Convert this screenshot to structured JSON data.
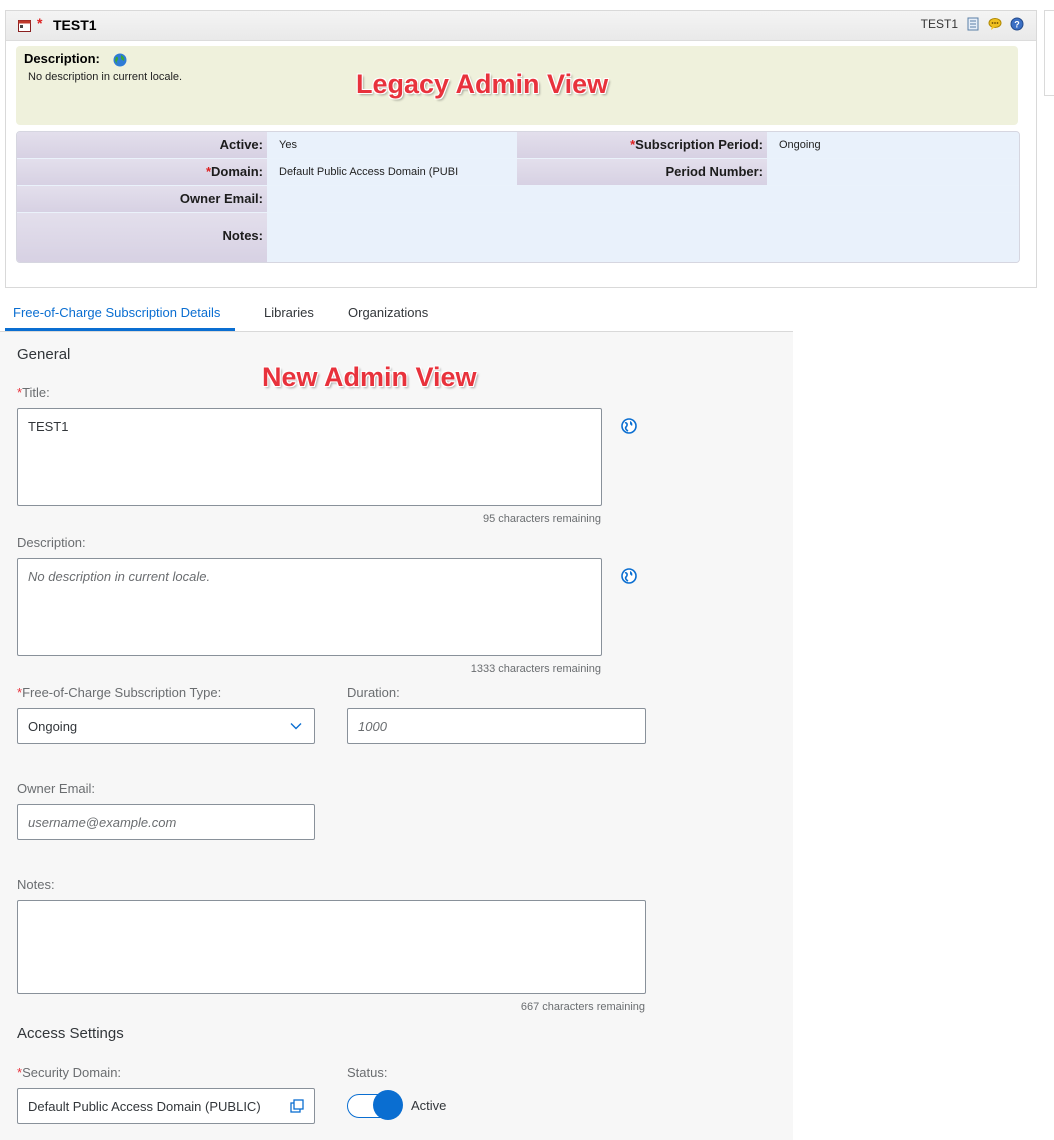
{
  "legacy": {
    "title": "TEST1",
    "header_right_text": "TEST1",
    "description_label": "Description:",
    "description_text": "No description in current locale.",
    "overlay_label": "Legacy Admin View",
    "rows": {
      "active_label": "Active:",
      "active_value": "Yes",
      "subscription_period_label": "Subscription Period:",
      "subscription_period_value": "Ongoing",
      "domain_label": "Domain:",
      "domain_value": "Default Public Access Domain (PUBI",
      "period_number_label": "Period Number:",
      "period_number_value": "",
      "owner_email_label": "Owner Email:",
      "owner_email_value": "",
      "notes_label": "Notes:",
      "notes_value": ""
    }
  },
  "tabs": [
    {
      "label": "Free-of-Charge Subscription Details",
      "active": true
    },
    {
      "label": "Libraries",
      "active": false
    },
    {
      "label": "Organizations",
      "active": false
    }
  ],
  "form": {
    "overlay_label": "New Admin View",
    "general_title": "General",
    "title_label": "Title:",
    "title_value": "TEST1",
    "title_counter": "95 characters remaining",
    "description_label": "Description:",
    "description_placeholder": "No description in current locale.",
    "description_counter": "1333 characters remaining",
    "type_label": "Free-of-Charge Subscription Type:",
    "type_value": "Ongoing",
    "duration_label": "Duration:",
    "duration_placeholder": "1000",
    "owner_email_label": "Owner Email:",
    "owner_email_placeholder": "username@example.com",
    "notes_label": "Notes:",
    "notes_counter": "667 characters remaining",
    "access_title": "Access Settings",
    "security_domain_label": "Security Domain:",
    "security_domain_value": "Default Public Access Domain (PUBLIC)",
    "status_label": "Status:",
    "status_value": "Active"
  },
  "colors": {
    "accent": "#0a6ed1",
    "required": "#e8323c",
    "legacy_desc_bg": "#eff1dc"
  }
}
